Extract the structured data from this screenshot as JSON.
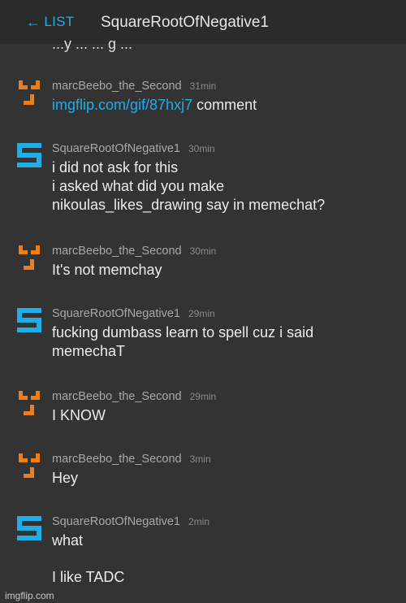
{
  "header": {
    "back_label": "LIST",
    "back_icon": "left-arrow-icon",
    "chat_title": "SquareRootOfNegative1"
  },
  "colors": {
    "background": "#333333",
    "header_bg": "#2b2b2b",
    "link": "#1eaee8",
    "orange_avatar": "#f07c1a",
    "blue_avatar": "#1eaee8"
  },
  "partial_top_line": "...y ... ... g ...",
  "messages": [
    {
      "user": "marcBeebo_the_Second",
      "time": "31min",
      "avatar": "marcbeebo-avatar-icon",
      "link": "imgflip.com/gif/87hxj7",
      "lines": [
        "comment"
      ]
    },
    {
      "user": "SquareRootOfNegative1",
      "time": "30min",
      "avatar": "square-s-avatar-icon",
      "lines": [
        "i did not ask for this",
        "i asked what did you make",
        "nikoulas_likes_drawing say in memechat?"
      ]
    },
    {
      "user": "marcBeebo_the_Second",
      "time": "30min",
      "avatar": "marcbeebo-avatar-icon",
      "lines": [
        "It's not memchay"
      ]
    },
    {
      "user": "SquareRootOfNegative1",
      "time": "29min",
      "avatar": "square-s-avatar-icon",
      "lines": [
        "fucking dumbass learn to spell cuz i said",
        "memechaT"
      ]
    },
    {
      "user": "marcBeebo_the_Second",
      "time": "29min",
      "avatar": "marcbeebo-avatar-icon",
      "lines": [
        "I KNOW"
      ]
    },
    {
      "user": "marcBeebo_the_Second",
      "time": "3min",
      "avatar": "marcbeebo-avatar-icon",
      "lines": [
        "Hey"
      ]
    },
    {
      "user": "SquareRootOfNegative1",
      "time": "2min",
      "avatar": "square-s-avatar-icon",
      "lines": [
        "what"
      ]
    }
  ],
  "trailing_line": "I like TADC",
  "watermark": "imgflip.com"
}
